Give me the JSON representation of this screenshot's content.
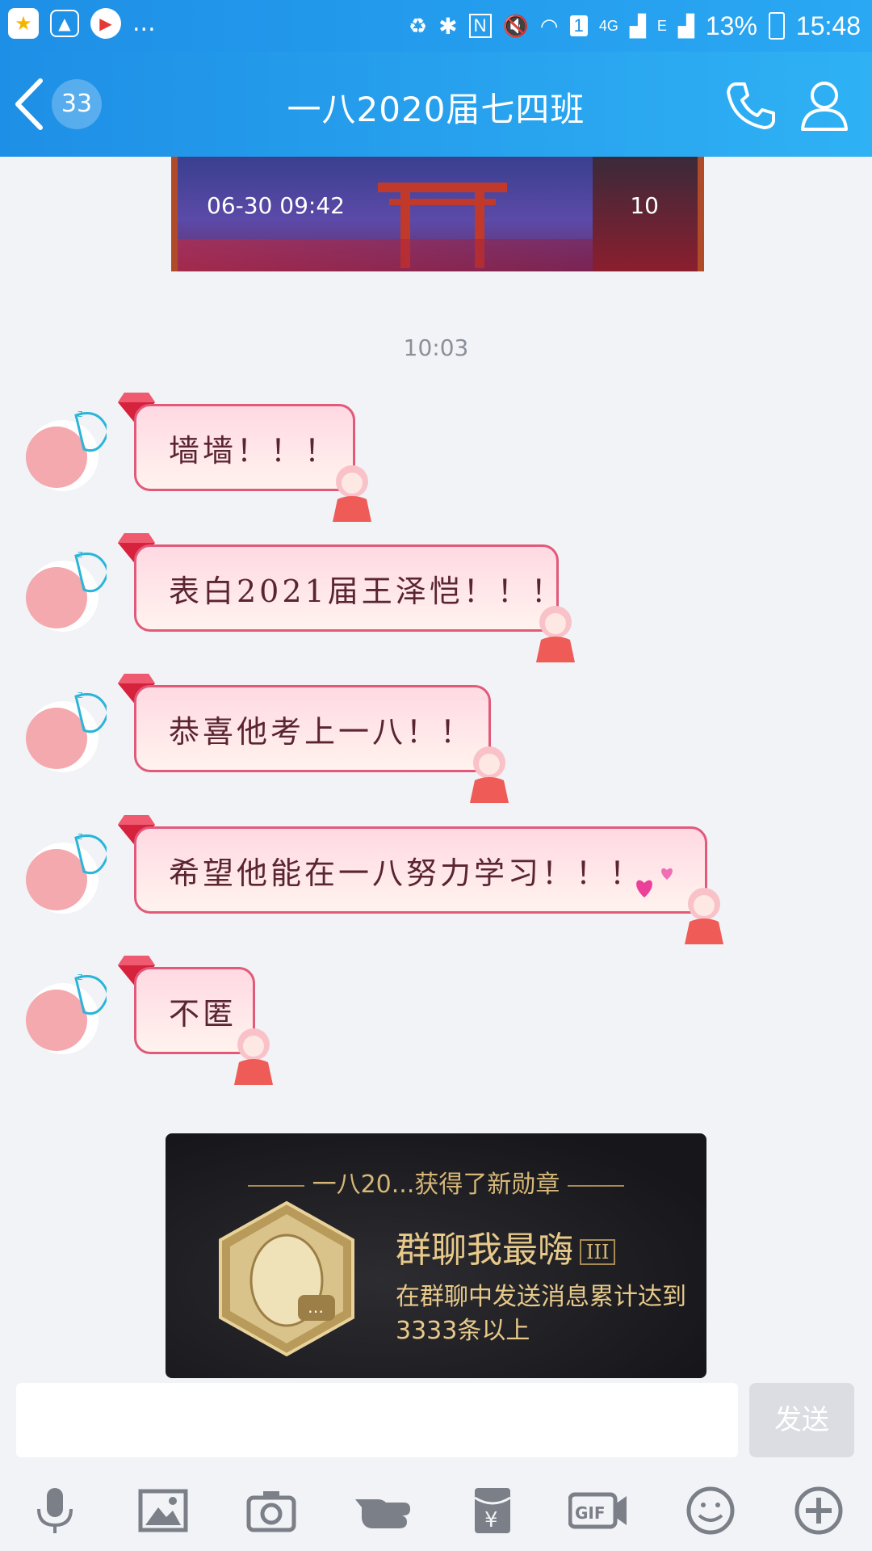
{
  "status_bar": {
    "overflow": "...",
    "sim_badge": "1",
    "network": "4G",
    "network2": "E",
    "battery": "13%",
    "time": "15:48"
  },
  "header": {
    "back_count": "33",
    "title": "一八2020届七四班"
  },
  "banner": {
    "date": "06-30 09:42",
    "count": "10"
  },
  "chat": {
    "timestamp": "10:03",
    "messages": [
      {
        "text": "墙墙！！！"
      },
      {
        "text": "表白2021届王泽恺！！！"
      },
      {
        "text": "恭喜他考上一八！！"
      },
      {
        "text": "希望他能在一八努力学习！！！"
      },
      {
        "text": "不匿"
      }
    ]
  },
  "badge_card": {
    "title": "一八20...获得了新勋章",
    "medal_name": "群聊我最嗨",
    "medal_level": "III",
    "description": "在群聊中发送消息累计达到3333条以上"
  },
  "composer": {
    "input_value": "",
    "send_label": "发送"
  },
  "toolbar": {
    "icons": [
      "microphone-icon",
      "image-icon",
      "camera-icon",
      "poke-icon",
      "red-packet-icon",
      "gif-icon",
      "emoji-icon",
      "plus-icon"
    ],
    "gif_label": "GIF",
    "yuan": "¥"
  },
  "colors": {
    "header_start": "#1e8fe6",
    "header_end": "#2fb1f4",
    "bubble_border": "#e15a7a",
    "medal_gold": "#e7c98a"
  }
}
